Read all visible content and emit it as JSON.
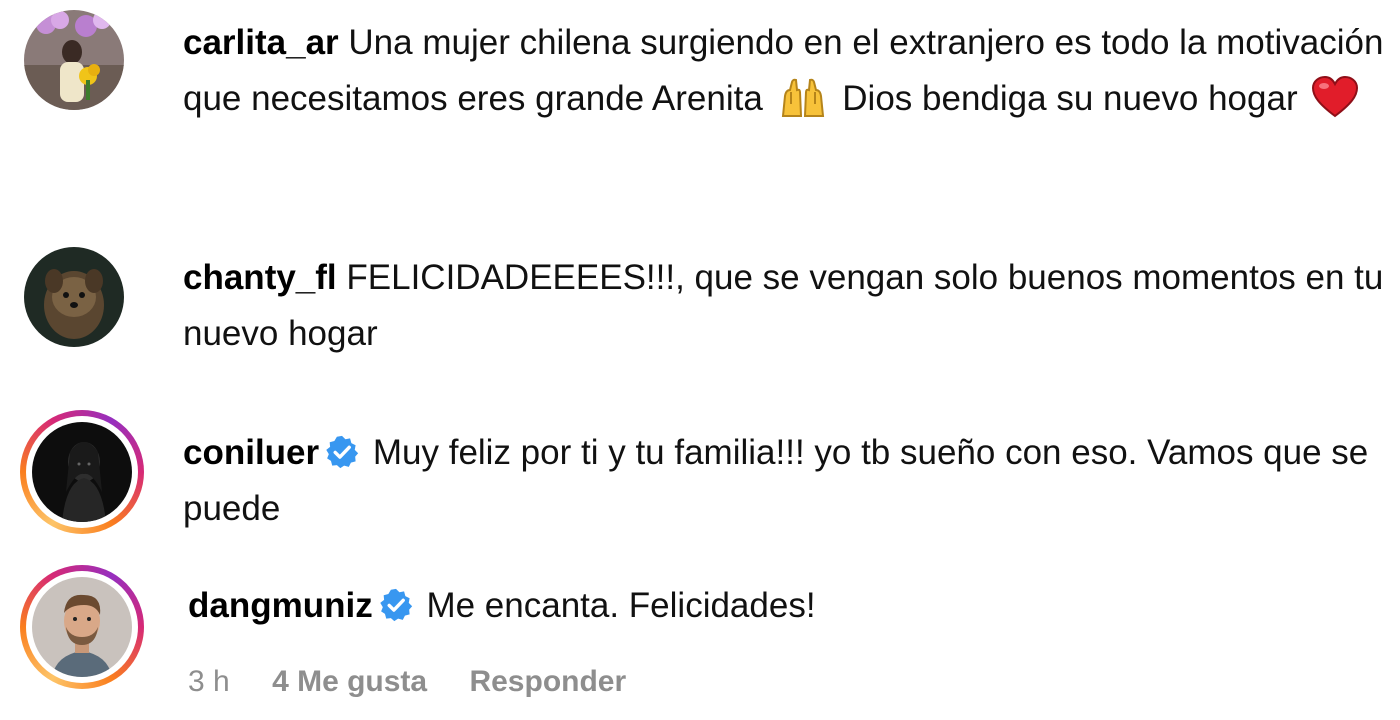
{
  "comments": [
    {
      "username": "carlita_ar",
      "verified": false,
      "text_part1": "Una mujer chilena surgiendo en el extranjero es todo la motivación que necesitamos eres grande Arenita",
      "emoji1": "raising-hands-emoji",
      "text_part2": "Dios bendiga su nuevo hogar",
      "emoji2": "red-heart-emoji"
    },
    {
      "username": "chanty_fl",
      "verified": false,
      "text": "FELICIDADEEEES!!!, que se vengan solo buenos momentos en tu nuevo hogar"
    },
    {
      "username": "coniluer",
      "verified": true,
      "text": "Muy feliz por ti y tu familia!!! yo tb sueño con eso. Vamos que se puede"
    },
    {
      "username": "dangmuniz",
      "verified": true,
      "text": "Me encanta. Felicidades!",
      "meta": {
        "time": "3 h",
        "likes": "4 Me gusta",
        "reply": "Responder"
      }
    }
  ],
  "colors": {
    "verified_badge": "#3897f0",
    "meta_text": "#8e8e8e",
    "heart": "#e11d2a"
  }
}
